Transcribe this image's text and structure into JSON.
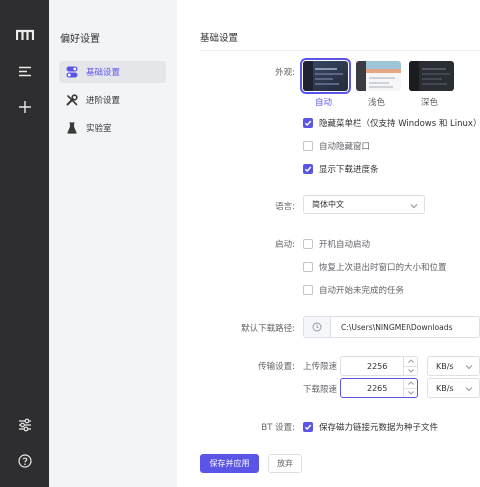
{
  "rail": {
    "top_icons": [
      "logo-m-icon",
      "task-list-icon",
      "plus-icon"
    ],
    "bottom_icons": [
      "sliders-icon",
      "help-icon"
    ]
  },
  "sidebar": {
    "title": "偏好设置",
    "items": [
      {
        "label": "基础设置",
        "icon": "toggle-icon",
        "active": true
      },
      {
        "label": "进阶设置",
        "icon": "tools-icon",
        "active": false
      },
      {
        "label": "实验室",
        "icon": "flask-icon",
        "active": false
      }
    ]
  },
  "main": {
    "section_title": "基础设置",
    "appearance": {
      "label": "外观:",
      "themes": [
        {
          "label": "自动",
          "selected": true
        },
        {
          "label": "浅色",
          "selected": false
        },
        {
          "label": "深色",
          "selected": false
        }
      ],
      "options": [
        {
          "label": "隐藏菜单栏（仅支持 Windows 和 Linux）",
          "checked": true
        },
        {
          "label": "自动隐藏窗口",
          "checked": false
        },
        {
          "label": "显示下载进度条",
          "checked": true
        }
      ]
    },
    "language": {
      "label": "语言:",
      "value": "简体中文"
    },
    "startup": {
      "label": "启动:",
      "options": [
        {
          "label": "开机自动启动",
          "checked": false
        },
        {
          "label": "恢复上次退出时窗口的大小和位置",
          "checked": false
        },
        {
          "label": "自动开始未完成的任务",
          "checked": false
        }
      ]
    },
    "download_path": {
      "label": "默认下载路径:",
      "value": "C:\\Users\\NINGMEI\\Downloads"
    },
    "transfer": {
      "label": "传输设置:",
      "upload_label": "上传限速",
      "upload_value": "2256",
      "upload_unit": "KB/s",
      "download_label": "下载限速",
      "download_value": "2265",
      "download_unit": "KB/s"
    },
    "bt": {
      "label": "BT 设置:",
      "option": "保存磁力链接元数据为种子文件",
      "checked": true
    },
    "buttons": {
      "save": "保存并应用",
      "discard": "放弃"
    }
  },
  "colors": {
    "accent": "#5b55e7",
    "rail_bg": "#2e2e30",
    "sidebar_bg": "#f3f4f6"
  }
}
